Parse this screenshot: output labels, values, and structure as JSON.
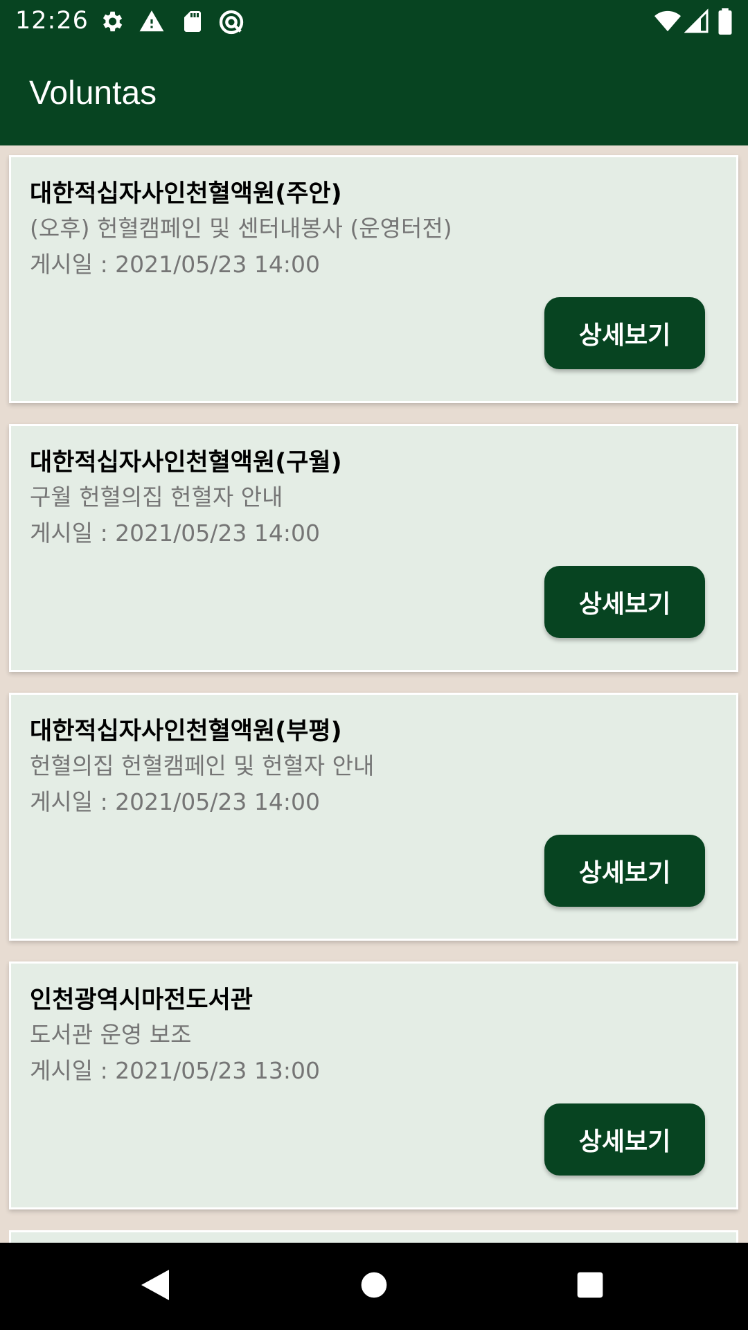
{
  "status_bar": {
    "time": "12:26",
    "icons": [
      "settings-icon",
      "warning-icon",
      "sd-card-icon",
      "sync-icon",
      "wifi-icon",
      "signal-icon",
      "battery-icon"
    ]
  },
  "app_bar": {
    "title": "Voluntas"
  },
  "colors": {
    "primary": "#074421",
    "card_bg": "#e4ede5",
    "page_bg": "#e7dcd2",
    "secondary_text": "#757575"
  },
  "cards": [
    {
      "title": "대한적십자사인천혈액원(주안)",
      "description": "(오후) 헌혈캠페인 및 센터내봉사 (운영터전)",
      "date": "게시일 : 2021/05/23 14:00",
      "button": "상세보기"
    },
    {
      "title": "대한적십자사인천혈액원(구월)",
      "description": "구월 헌혈의집 헌혈자 안내",
      "date": "게시일 : 2021/05/23 14:00",
      "button": "상세보기"
    },
    {
      "title": "대한적십자사인천혈액원(부평)",
      "description": "헌혈의집 헌혈캠페인 및 헌혈자 안내",
      "date": "게시일 : 2021/05/23 14:00",
      "button": "상세보기"
    },
    {
      "title": "인천광역시마전도서관",
      "description": "도서관 운영 보조",
      "date": "게시일 : 2021/05/23 13:00",
      "button": "상세보기"
    }
  ],
  "nav_bar": {
    "icons": [
      "back-icon",
      "home-icon",
      "recents-icon"
    ]
  }
}
